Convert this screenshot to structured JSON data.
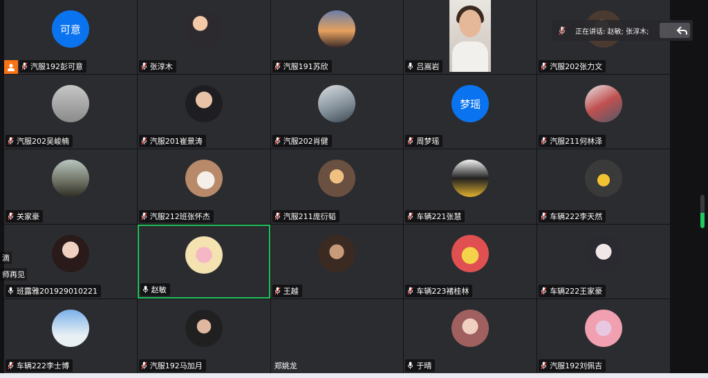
{
  "speaking_now": {
    "text": "正在讲话: 赵敏; 张淳木;"
  },
  "chat_overlay": [
    "滴",
    "师再见"
  ],
  "mic_level": 0.45,
  "colors": {
    "active_border": "#22c55e",
    "avatar_blue": "#0a74f0",
    "host_orange": "#f97316",
    "tile_bg": "#2b2c30"
  },
  "participants": [
    {
      "name": "汽服192彭可意",
      "avatar_text": "可意",
      "host": true,
      "mic": "muted"
    },
    {
      "name": "张淳木",
      "avatar": "photo",
      "mic": "muted"
    },
    {
      "name": "汽服191苏欣",
      "avatar": "photo",
      "mic": "muted"
    },
    {
      "name": "吕嵩岩",
      "video": true,
      "mic": "on"
    },
    {
      "name": "汽服202张力文",
      "avatar": "photo",
      "mic": "muted"
    },
    {
      "name": "汽服202吴峻楠",
      "avatar": "photo",
      "mic": "muted"
    },
    {
      "name": "汽服201崔景涛",
      "avatar": "photo",
      "mic": "muted"
    },
    {
      "name": "汽服202肖健",
      "avatar": "photo",
      "mic": "muted"
    },
    {
      "name": "周梦瑶",
      "avatar_text": "梦瑶",
      "mic": "muted"
    },
    {
      "name": "汽服211何林泽",
      "avatar": "photo",
      "mic": "muted"
    },
    {
      "name": "关家豪",
      "avatar": "photo",
      "mic": "muted"
    },
    {
      "name": "汽服212班张怀杰",
      "avatar": "photo",
      "mic": "muted"
    },
    {
      "name": "汽服211庞衍韬",
      "avatar": "photo",
      "mic": "muted"
    },
    {
      "name": "车辆221张慧",
      "avatar": "photo",
      "mic": "muted"
    },
    {
      "name": "车辆222李天然",
      "avatar": "photo",
      "mic": "muted"
    },
    {
      "name": "班露雅201929010221",
      "avatar": "photo",
      "mic": "on"
    },
    {
      "name": "赵敏",
      "avatar": "photo",
      "mic": "on",
      "active": true
    },
    {
      "name": "王越",
      "avatar": "photo",
      "mic": "muted"
    },
    {
      "name": "车辆223褚桂林",
      "avatar": "photo",
      "mic": "muted"
    },
    {
      "name": "车辆222王家豪",
      "avatar": "photo",
      "mic": "muted"
    },
    {
      "name": "车辆222李士博",
      "avatar": "photo",
      "mic": "muted"
    },
    {
      "name": "汽服192马加月",
      "avatar": "photo",
      "mic": "muted"
    },
    {
      "name": "郑姚龙",
      "avatar": "none",
      "mic": "none"
    },
    {
      "name": "于晴",
      "avatar": "photo",
      "mic": "on"
    },
    {
      "name": "汽服192刘佩吉",
      "avatar": "photo",
      "mic": "muted"
    }
  ]
}
